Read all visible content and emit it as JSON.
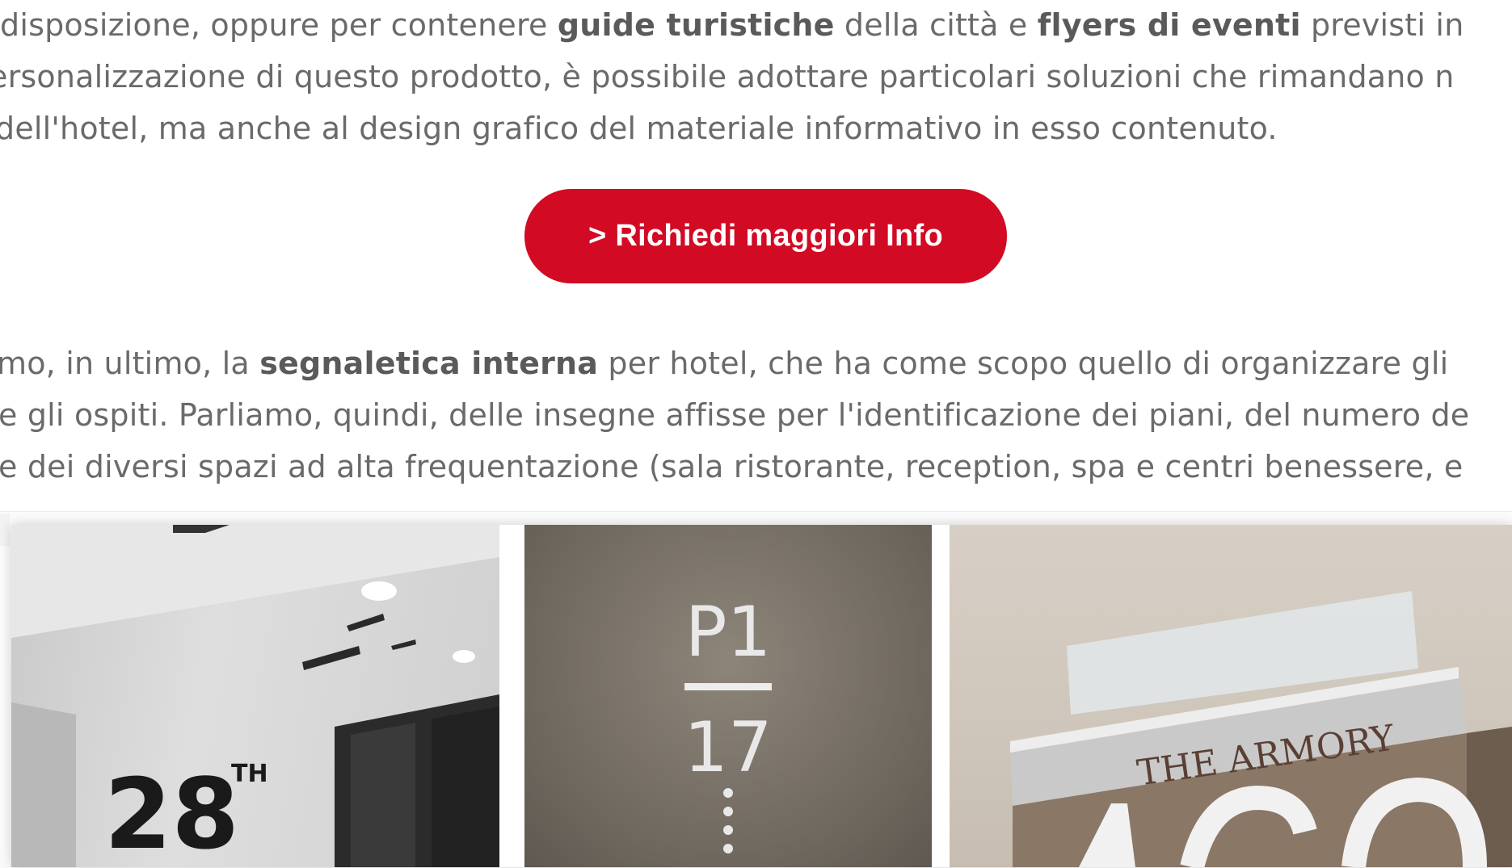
{
  "intro_paragraph": {
    "line1": {
      "t1": "disposizione, oppure per contenere ",
      "b1": "guide turistiche",
      "t2": " della città e ",
      "b2": "flyers di eventi",
      "t3": " previsti in"
    },
    "line2": "ersonalizzazione di questo prodotto, è possibile adottare particolari soluzioni che rimandano n",
    "line3": " dell'hotel, ma anche al design grafico del materiale informativo in esso contenuto."
  },
  "cta_button": {
    "label": "> Richiedi maggiori Info",
    "color": "#d20a24"
  },
  "signage_paragraph": {
    "line1": {
      "t1": "mo, in ultimo, la ",
      "b1": "segnaletica interna",
      "t2": " per hotel, che ha come scopo quello di organizzare gli"
    },
    "line2": "e gli ospiti. Parliamo, quindi, delle insegne affisse per l'identificazione dei piani, del numero de",
    "line3": "e dei diversi spazi ad alta frequentazione (sala ristorante, reception, spa e centri benessere, e"
  },
  "gallery": {
    "photo1": {
      "sign_number": "28",
      "sign_suffix": "TH"
    },
    "photo2": {
      "sign_top": "P1",
      "sign_bottom": "17"
    },
    "photo3": {
      "sign_text": "THE ARMORY"
    }
  }
}
